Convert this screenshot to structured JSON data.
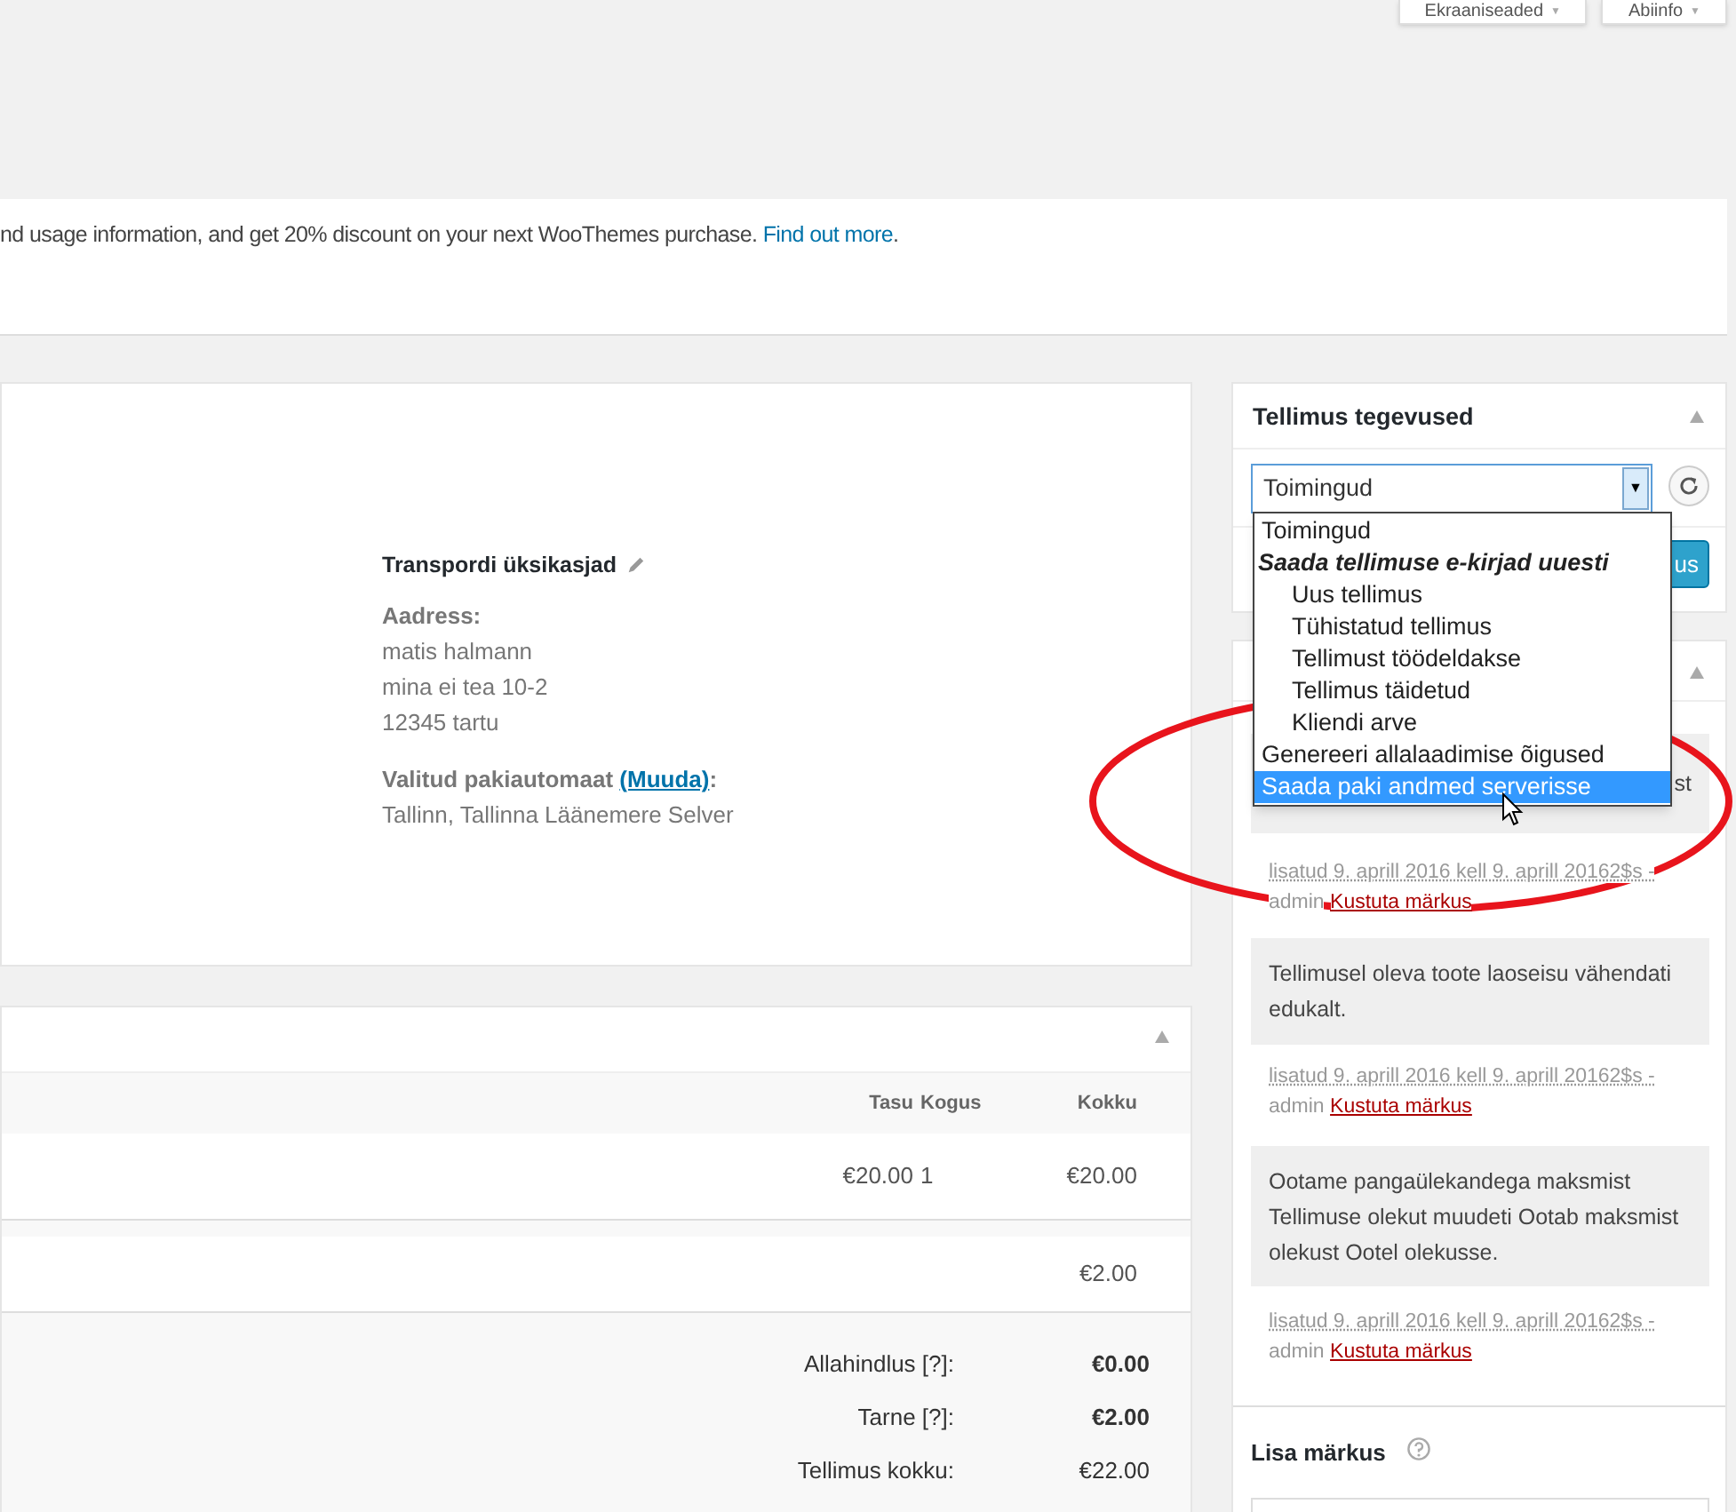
{
  "top_buttons": [
    {
      "label": "Ekraaniseaded",
      "icon": "▼"
    },
    {
      "label": "Abiinfo",
      "icon": "▼"
    }
  ],
  "notice": {
    "text": "nd usage information, and get 20% discount on your next WooThemes purchase.",
    "link": "Find out more",
    "after": "."
  },
  "shipping": {
    "title": "Transpordi üksikasjad",
    "address_label": "Aadress:",
    "address_lines": [
      "matis halmann",
      "mina ei tea 10-2",
      "12345 tartu"
    ],
    "terminal_label": "Valitud pakiautomaat",
    "terminal_link": "(Muuda)",
    "terminal_colon": ":",
    "terminal_value": "Tallinn, Tallinna Läänemere Selver"
  },
  "items": {
    "columns": [
      "Tasu",
      "Kogus",
      "Kokku"
    ],
    "rows": [
      [
        "€20.00",
        "1",
        "€20.00"
      ]
    ],
    "shipping_total": "€2.00",
    "totals": [
      {
        "label": "Allahindlus [?]:",
        "value": "€0.00",
        "bold": true
      },
      {
        "label": "Tarne [?]:",
        "value": "€2.00",
        "bold": true
      },
      {
        "label": "Tellimus kokku:",
        "value": "€22.00",
        "bold": false
      }
    ]
  },
  "actions": {
    "title": "Tellimus tegevused",
    "select_value": "Toimingud",
    "button_visible": "us",
    "dropdown": [
      {
        "label": "Toimingud",
        "kind": "option",
        "selected": false
      },
      {
        "label": "Saada tellimuse e-kirjad uuesti",
        "kind": "group",
        "selected": false,
        "children": [
          {
            "label": "Uus tellimus",
            "kind": "option",
            "selected": false
          },
          {
            "label": "Tühistatud tellimus",
            "kind": "option",
            "selected": false
          },
          {
            "label": "Tellimust töödeldakse",
            "kind": "option",
            "selected": false
          },
          {
            "label": "Tellimus täidetud",
            "kind": "option",
            "selected": false
          },
          {
            "label": "Kliendi arve",
            "kind": "option",
            "selected": false
          }
        ]
      },
      {
        "label": "Genereeri allalaadimise õigused",
        "kind": "option",
        "selected": false
      },
      {
        "label": "Saada paki andmed serverisse",
        "kind": "option",
        "selected": true
      }
    ]
  },
  "notes": {
    "items": [
      {
        "text": "st",
        "meta": "lisatud 9. aprill 2016 kell 9. aprill 20162$s -",
        "author": "admin",
        "delete": "Kustuta märkus"
      },
      {
        "text": "Tellimusel oleva toote laoseisu vähendati edukalt.",
        "meta": "lisatud 9. aprill 2016 kell 9. aprill 20162$s -",
        "author": "admin",
        "delete": "Kustuta märkus"
      },
      {
        "text": "Ootame pangaülekandega maksmist Tellimuse olekut muudeti Ootab maksmist olekust Ootel olekusse.",
        "meta": "lisatud 9. aprill 2016 kell 9. aprill 20162$s -",
        "author": "admin",
        "delete": "Kustuta märkus"
      }
    ],
    "add_title": "Lisa märkus"
  }
}
